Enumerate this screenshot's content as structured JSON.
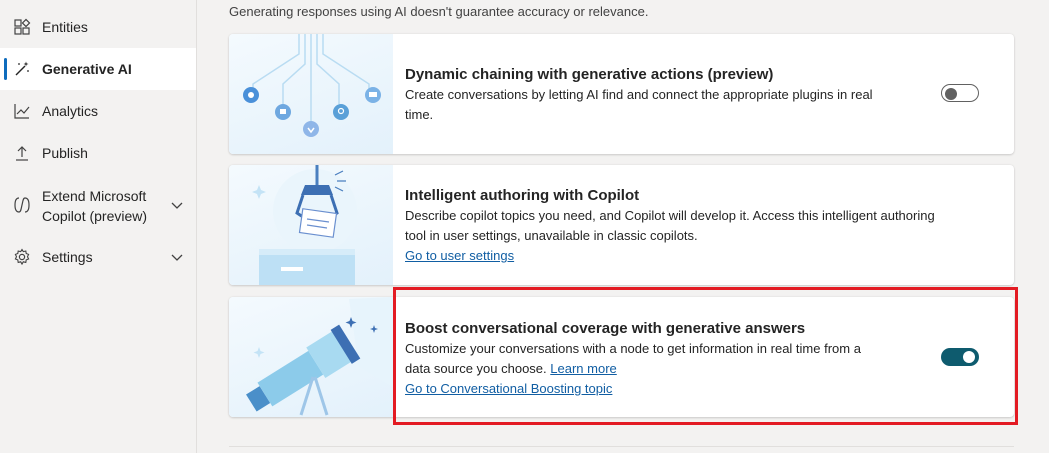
{
  "sidebar": {
    "items": [
      {
        "label": "Entities",
        "icon": "entities-icon"
      },
      {
        "label": "Generative AI",
        "icon": "magic-wand-icon",
        "active": true
      },
      {
        "label": "Analytics",
        "icon": "analytics-icon"
      },
      {
        "label": "Publish",
        "icon": "publish-icon"
      },
      {
        "label_line1": "Extend Microsoft",
        "label_line2": "Copilot (preview)",
        "icon": "copilot-icon",
        "expandable": true
      },
      {
        "label": "Settings",
        "icon": "gear-icon",
        "expandable": true
      }
    ]
  },
  "main": {
    "disclaimer": "Generating responses using AI doesn't guarantee accuracy or relevance.",
    "cards": [
      {
        "title": "Dynamic chaining with generative actions (preview)",
        "desc_line1": "Create conversations by letting AI find and connect the appropriate plugins in real",
        "desc_line2": "time.",
        "toggle": "off"
      },
      {
        "title": "Intelligent authoring with Copilot",
        "desc_line1": "Describe copilot topics you need, and Copilot will develop it. Access this intelligent authoring",
        "desc_line2": "tool in user settings, unavailable in classic copilots.",
        "link": "Go to user settings"
      },
      {
        "title": "Boost conversational coverage with generative answers",
        "desc_line1": "Customize your conversations with a node to get information in real time from a",
        "desc_line2_prefix": "data source you choose.",
        "learn_more": "Learn more",
        "link": "Go to Conversational Boosting topic",
        "toggle": "on"
      }
    ]
  },
  "colors": {
    "accent": "#0e5b6e",
    "highlight": "#e31b23",
    "link": "#115ea3",
    "nav_active": "#0f6cbd"
  }
}
